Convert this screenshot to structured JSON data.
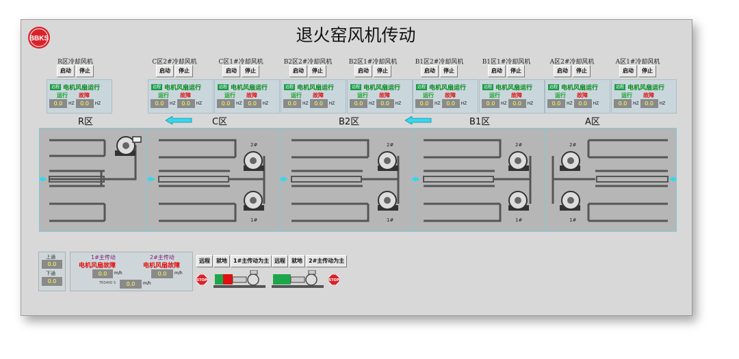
{
  "window": {
    "title": "退火窑风机传动",
    "logo_text": "BBKS"
  },
  "fans": [
    {
      "label": "R区冷却风机",
      "start": "启动",
      "stop": "停止"
    },
    {
      "label": "C区2#冷却风机",
      "start": "启动",
      "stop": "停止"
    },
    {
      "label": "C区1#冷却风机",
      "start": "启动",
      "stop": "停止"
    },
    {
      "label": "B2区2#冷却风机",
      "start": "启动",
      "stop": "停止"
    },
    {
      "label": "B2区1#冷却风机",
      "start": "启动",
      "stop": "停止"
    },
    {
      "label": "B1区2#冷却风机",
      "start": "启动",
      "stop": "停止"
    },
    {
      "label": "B1区1#冷却风机",
      "start": "启动",
      "stop": "停止"
    },
    {
      "label": "A区2#冷却风机",
      "start": "启动",
      "stop": "停止"
    },
    {
      "label": "A区1#冷却风机",
      "start": "启动",
      "stop": "停止"
    }
  ],
  "status": {
    "remote": "远程",
    "running": "电机风扇运行",
    "run": "运行",
    "fault": "故障",
    "val1": "0.0",
    "val2": "0.0",
    "unit": "HZ"
  },
  "zones": {
    "r": "R区",
    "c": "C区",
    "b2": "B2区",
    "b1": "B1区",
    "a": "A区"
  },
  "motor_tags": {
    "m2": "2#",
    "m1": "1#"
  },
  "pressure": {
    "upper_label": "上通",
    "upper_value": "0.0",
    "lower_label": "下通",
    "lower_value": "0.0"
  },
  "main_drive": {
    "d1_label": "1#主传动",
    "d1_status": "电机风扇故障",
    "d1_value": "0.0",
    "d2_label": "2#主传动",
    "d2_status": "电机风扇故障",
    "d2_value": "0.0",
    "unit": "m/h",
    "speed_label": "TRS400 S",
    "speed_value": "0.0",
    "speed_unit": "m/h"
  },
  "controls": {
    "remote": "远程",
    "local": "就地",
    "main1": "1#主传动为主",
    "main2": "2#主传动为主",
    "stop": "STOP"
  },
  "colors": {
    "accent_cyan": "#37d6ec",
    "run_green": "#12a021",
    "fault_red": "#e01010",
    "value_yellow": "#ffff60"
  }
}
